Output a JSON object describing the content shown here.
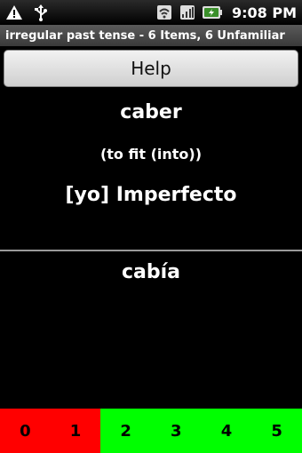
{
  "status_bar": {
    "time": "9:08 PM",
    "icons_left": [
      "warning-icon",
      "usb-icon"
    ],
    "icons_right": [
      "wifi-icon",
      "signal-icon",
      "battery-icon"
    ]
  },
  "title": "irregular past tense - 6 Items, 6 Unfamiliar",
  "help_label": "Help",
  "card": {
    "word": "caber",
    "translation": "(to fit (into))",
    "tense": "[yo] Imperfecto",
    "answer": "cabía"
  },
  "ratings": [
    {
      "label": "0",
      "color": "#ff0000"
    },
    {
      "label": "1",
      "color": "#ff0000"
    },
    {
      "label": "2",
      "color": "#00ff00"
    },
    {
      "label": "3",
      "color": "#00ff00"
    },
    {
      "label": "4",
      "color": "#00ff00"
    },
    {
      "label": "5",
      "color": "#00ff00"
    }
  ]
}
